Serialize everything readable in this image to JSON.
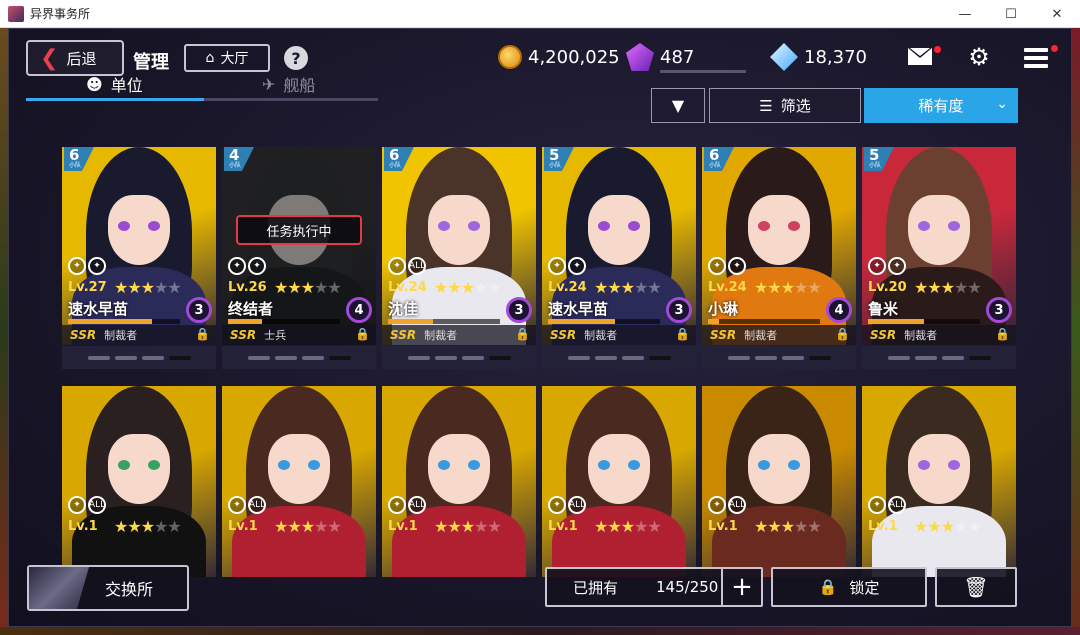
{
  "window": {
    "title": "异界事务所",
    "min": "—",
    "max": "☐",
    "close": "✕"
  },
  "header": {
    "back_label": "后退",
    "title": "管理",
    "lobby_label": "大厅",
    "help": "?",
    "coins": "4,200,025",
    "gems": "487",
    "crystals": "18,370"
  },
  "tabs": [
    {
      "label": "单位",
      "active": true
    },
    {
      "label": "舰船",
      "active": false
    }
  ],
  "toolbar": {
    "sort_dir": "▼",
    "filter_label": "筛选",
    "sort_label": "稀有度",
    "caret": "⌄"
  },
  "cards": [
    {
      "squad": "6",
      "squad_unit": "小队",
      "lv": "Lv.27",
      "stars": 3,
      "name": "速水早苗",
      "rank": "3",
      "rarity": "SSR",
      "cls": "制裁者",
      "xp": 0.75,
      "icons": [
        "target-icon",
        "wing-icon"
      ],
      "dim": false,
      "status": "",
      "palette": [
        "#e6b800",
        "#1a1a2e",
        "#2b2b5a",
        "#9b4bd0"
      ]
    },
    {
      "squad": "4",
      "squad_unit": "小队",
      "lv": "Lv.26",
      "stars": 3,
      "name": "终结者",
      "rank": "4",
      "rarity": "SSR",
      "cls": "士兵",
      "xp": 0.3,
      "icons": [
        "swords-icon",
        "wing-icon"
      ],
      "dim": true,
      "status": "任务执行中",
      "palette": [
        "#3a3a4a",
        "#2b3b4a",
        "#1a2a3a",
        "#3dd0d0"
      ]
    },
    {
      "squad": "6",
      "squad_unit": "小队",
      "lv": "Lv.24",
      "stars": 3,
      "name": "沈佳",
      "rank": "3",
      "rarity": "SSR",
      "cls": "制裁者",
      "xp": 0.4,
      "icons": [
        "rifle-icon",
        "all-icon"
      ],
      "dim": false,
      "status": "",
      "palette": [
        "#f0c400",
        "#4a3328",
        "#e8e8ee",
        "#a066e0"
      ]
    },
    {
      "squad": "5",
      "squad_unit": "小队",
      "lv": "Lv.24",
      "stars": 3,
      "name": "速水早苗",
      "rank": "3",
      "rarity": "SSR",
      "cls": "制裁者",
      "xp": 0.6,
      "icons": [
        "target-icon",
        "wing-icon"
      ],
      "dim": false,
      "status": "",
      "palette": [
        "#e6b800",
        "#1a1a2e",
        "#2b2b5a",
        "#9b4bd0"
      ]
    },
    {
      "squad": "6",
      "squad_unit": "小队",
      "lv": "Lv.24",
      "stars": 3,
      "name": "小琳",
      "rank": "4",
      "rarity": "SSR",
      "cls": "制裁者",
      "xp": 0.1,
      "icons": [
        "target-icon",
        "wing-icon"
      ],
      "dim": false,
      "status": "",
      "palette": [
        "#e0a800",
        "#2a1a1a",
        "#e07a10",
        "#d04060"
      ]
    },
    {
      "squad": "5",
      "squad_unit": "小队",
      "lv": "Lv.20",
      "stars": 3,
      "name": "鲁米",
      "rank": "3",
      "rarity": "SSR",
      "cls": "制裁者",
      "xp": 0.5,
      "icons": [
        "gun-icon",
        "wing-icon"
      ],
      "dim": false,
      "status": "",
      "palette": [
        "#c9283a",
        "#6b4030",
        "#2a1a1a",
        "#a066e0"
      ]
    },
    {
      "squad": "",
      "squad_unit": "",
      "lv": "Lv.1",
      "stars": 3,
      "name": "",
      "rank": "",
      "rarity": "",
      "cls": "",
      "xp": 0,
      "icons": [
        "rifle-icon",
        "all-icon"
      ],
      "dim": false,
      "status": "",
      "palette": [
        "#d9a800",
        "#2a2020",
        "#111111",
        "#3aa060"
      ]
    },
    {
      "squad": "",
      "squad_unit": "",
      "lv": "Lv.1",
      "stars": 3,
      "name": "",
      "rank": "",
      "rarity": "",
      "cls": "",
      "xp": 0,
      "icons": [
        "rifle-icon",
        "all-icon"
      ],
      "dim": false,
      "status": "",
      "palette": [
        "#d9a800",
        "#4a2a20",
        "#b02030",
        "#3a9ae0"
      ]
    },
    {
      "squad": "",
      "squad_unit": "",
      "lv": "Lv.1",
      "stars": 3,
      "name": "",
      "rank": "",
      "rarity": "",
      "cls": "",
      "xp": 0,
      "icons": [
        "rifle-icon",
        "all-icon"
      ],
      "dim": false,
      "status": "",
      "palette": [
        "#d9a800",
        "#4a2a20",
        "#b02030",
        "#3a9ae0"
      ]
    },
    {
      "squad": "",
      "squad_unit": "",
      "lv": "Lv.1",
      "stars": 3,
      "name": "",
      "rank": "",
      "rarity": "",
      "cls": "",
      "xp": 0,
      "icons": [
        "rifle-icon",
        "all-icon"
      ],
      "dim": false,
      "status": "",
      "palette": [
        "#d9a800",
        "#4a2a20",
        "#b02030",
        "#3a9ae0"
      ]
    },
    {
      "squad": "",
      "squad_unit": "",
      "lv": "Lv.1",
      "stars": 3,
      "name": "",
      "rank": "",
      "rarity": "",
      "cls": "",
      "xp": 0,
      "icons": [
        "sparkle-icon",
        "all-icon"
      ],
      "dim": false,
      "status": "",
      "palette": [
        "#c98a00",
        "#3a2418",
        "#6a2a20",
        "#3a9ae0"
      ]
    },
    {
      "squad": "",
      "squad_unit": "",
      "lv": "Lv.1",
      "stars": 3,
      "name": "",
      "rank": "",
      "rarity": "",
      "cls": "",
      "xp": 0,
      "icons": [
        "rifle-icon",
        "all-icon"
      ],
      "dim": false,
      "status": "",
      "palette": [
        "#d9a800",
        "#3a2a20",
        "#e8e8ee",
        "#a066e0"
      ]
    }
  ],
  "footer": {
    "exchange_label": "交换所",
    "owned_label": "已拥有",
    "owned_value": "145/250",
    "plus": "+",
    "lock_label": "锁定",
    "trash": "🗑"
  }
}
